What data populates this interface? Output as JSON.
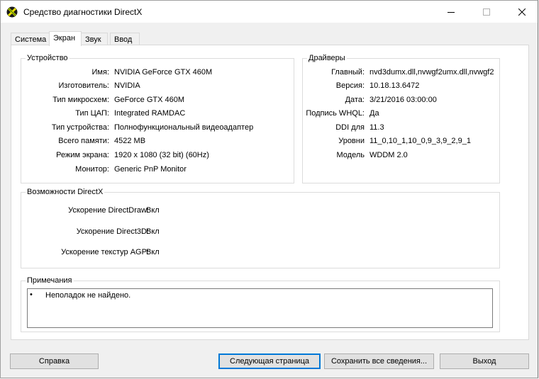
{
  "window": {
    "title": "Средство диагностики DirectX"
  },
  "tabs": [
    {
      "label": "Система"
    },
    {
      "label": "Экран"
    },
    {
      "label": "Звук"
    },
    {
      "label": "Ввод"
    }
  ],
  "device": {
    "title": "Устройство",
    "rows": [
      {
        "label": "Имя:",
        "value": "NVIDIA GeForce GTX 460M"
      },
      {
        "label": "Изготовитель:",
        "value": "NVIDIA"
      },
      {
        "label": "Тип микросхем:",
        "value": "GeForce GTX 460M"
      },
      {
        "label": "Тип ЦАП:",
        "value": "Integrated RAMDAC"
      },
      {
        "label": "Тип устройства:",
        "value": "Полнофункциональный видеоадаптер"
      },
      {
        "label": "Всего памяти:",
        "value": "4522 MB"
      },
      {
        "label": "Режим экрана:",
        "value": "1920 x 1080 (32 bit) (60Hz)"
      },
      {
        "label": "Монитор:",
        "value": "Generic PnP Monitor"
      }
    ]
  },
  "drivers": {
    "title": "Драйверы",
    "rows": [
      {
        "label": "Главный:",
        "value": "nvd3dumx.dll,nvwgf2umx.dll,nvwgf2"
      },
      {
        "label": "Версия:",
        "value": "10.18.13.6472"
      },
      {
        "label": "Дата:",
        "value": "3/21/2016 03:00:00"
      },
      {
        "label": "Подпись WHQL:",
        "value": "Да"
      },
      {
        "label": "DDI для",
        "value": "11.3"
      },
      {
        "label": "Уровни",
        "value": "11_0,10_1,10_0,9_3,9_2,9_1"
      },
      {
        "label": "Модель",
        "value": "WDDM 2.0"
      }
    ]
  },
  "features": {
    "title": "Возможности DirectX",
    "rows": [
      {
        "label": "Ускорение DirectDraw:",
        "value": "Вкл"
      },
      {
        "label": "Ускорение Direct3D:",
        "value": "Вкл"
      },
      {
        "label": "Ускорение текстур AGP:",
        "value": "Вкл"
      }
    ]
  },
  "notes": {
    "title": "Примечания",
    "items": [
      "Неполадок не найдено."
    ]
  },
  "buttons": {
    "help": "Справка",
    "next_page": "Следующая страница",
    "save_all": "Сохранить все сведения...",
    "exit": "Выход"
  }
}
